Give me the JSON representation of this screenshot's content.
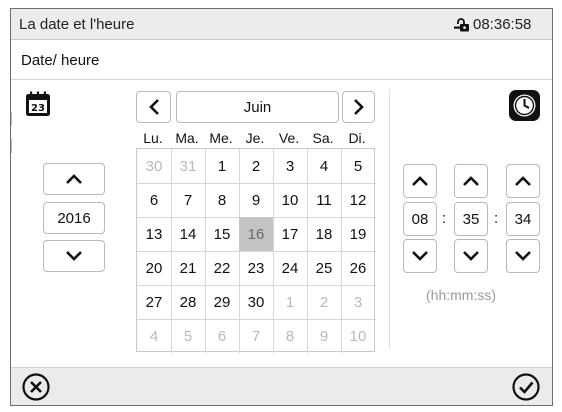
{
  "header": {
    "title": "La date et l'heure",
    "clock": "08:36:58"
  },
  "section": {
    "title": "Date/ heure"
  },
  "calendar": {
    "month": "Juin",
    "year": "2016",
    "weekdays": [
      "Lu.",
      "Ma.",
      "Me.",
      "Je.",
      "Ve.",
      "Sa.",
      "Di."
    ],
    "selected_day": "16",
    "weeks": [
      [
        {
          "d": "30",
          "o": true
        },
        {
          "d": "31",
          "o": true
        },
        {
          "d": "1"
        },
        {
          "d": "2"
        },
        {
          "d": "3"
        },
        {
          "d": "4"
        },
        {
          "d": "5"
        }
      ],
      [
        {
          "d": "6"
        },
        {
          "d": "7"
        },
        {
          "d": "8"
        },
        {
          "d": "9"
        },
        {
          "d": "10"
        },
        {
          "d": "11"
        },
        {
          "d": "12"
        }
      ],
      [
        {
          "d": "13"
        },
        {
          "d": "14"
        },
        {
          "d": "15"
        },
        {
          "d": "16",
          "s": true
        },
        {
          "d": "17"
        },
        {
          "d": "18"
        },
        {
          "d": "19"
        }
      ],
      [
        {
          "d": "20"
        },
        {
          "d": "21"
        },
        {
          "d": "22"
        },
        {
          "d": "23"
        },
        {
          "d": "24"
        },
        {
          "d": "25"
        },
        {
          "d": "26"
        }
      ],
      [
        {
          "d": "27"
        },
        {
          "d": "28"
        },
        {
          "d": "29"
        },
        {
          "d": "30"
        },
        {
          "d": "1",
          "o": true
        },
        {
          "d": "2",
          "o": true
        },
        {
          "d": "3",
          "o": true
        }
      ],
      [
        {
          "d": "4",
          "o": true
        },
        {
          "d": "5",
          "o": true
        },
        {
          "d": "6",
          "o": true
        },
        {
          "d": "7",
          "o": true
        },
        {
          "d": "8",
          "o": true
        },
        {
          "d": "9",
          "o": true
        },
        {
          "d": "10",
          "o": true
        }
      ]
    ]
  },
  "time": {
    "hours": "08",
    "minutes": "35",
    "seconds": "34",
    "separator": ":",
    "format_hint": "(hh:mm:ss)"
  },
  "icons": {
    "lock": "lock-icon",
    "calendar": "calendar-icon",
    "clock": "clock-icon",
    "cancel": "cancel-circle-icon",
    "confirm": "confirm-check-icon",
    "up": "chevron-up-icon",
    "down": "chevron-down-icon",
    "prev": "chevron-left-icon",
    "next": "chevron-right-icon"
  },
  "colors": {
    "selected_day_bg": "#c4c4c4",
    "other_month_text": "#b9b9b9",
    "bar_bg": "#ebebeb"
  }
}
